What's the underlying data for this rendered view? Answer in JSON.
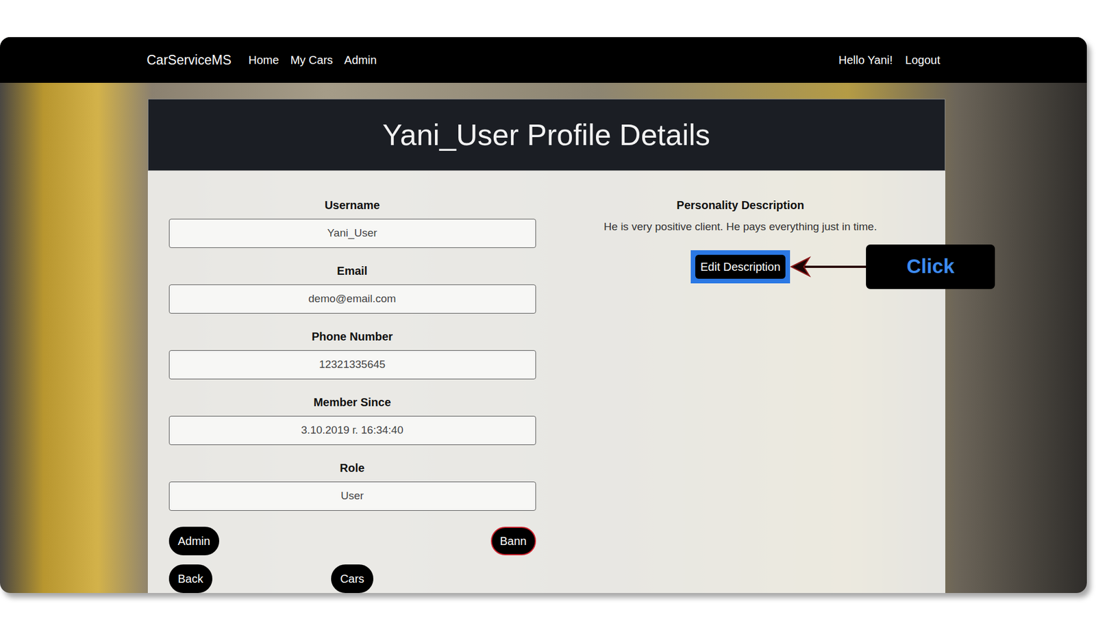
{
  "navbar": {
    "brand": "CarServiceMS",
    "links": [
      {
        "label": "Home"
      },
      {
        "label": "My Cars"
      },
      {
        "label": "Admin"
      }
    ],
    "greeting": "Hello Yani!",
    "logout": "Logout"
  },
  "profile": {
    "title": "Yani_User Profile Details",
    "fields": [
      {
        "label": "Username",
        "value": "Yani_User"
      },
      {
        "label": "Email",
        "value": "demo@email.com"
      },
      {
        "label": "Phone Number",
        "value": "12321335645"
      },
      {
        "label": "Member Since",
        "value": "3.10.2019 г. 16:34:40"
      },
      {
        "label": "Role",
        "value": "User"
      }
    ],
    "button_rows": [
      [
        {
          "label": "Admin",
          "kind": "plain"
        },
        {
          "label": "Bann",
          "kind": "danger"
        }
      ],
      [
        {
          "label": "Back",
          "kind": "plain"
        },
        {
          "label": "Cars",
          "kind": "plain"
        }
      ]
    ],
    "description": {
      "label": "Personality Description",
      "text": "He is very positive client. He pays everything just in time.",
      "button": {
        "label": "Edit Description",
        "highlighted": true
      }
    }
  },
  "annotation": {
    "text": "Click"
  }
}
